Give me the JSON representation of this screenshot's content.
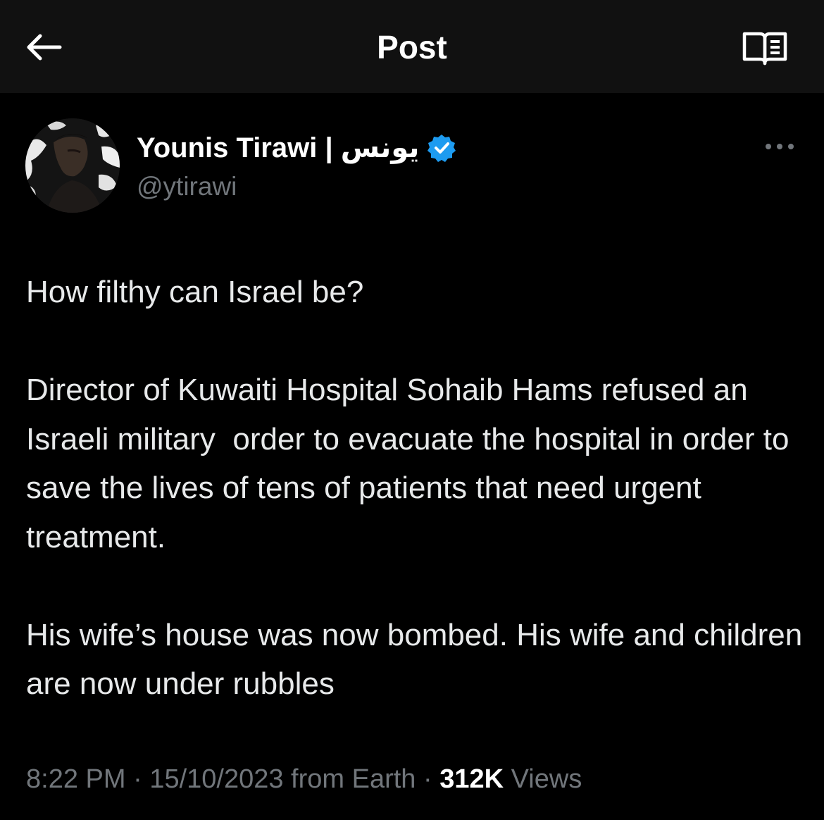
{
  "header": {
    "title": "Post",
    "back_icon": "arrow-left-icon",
    "reader_icon": "reader-mode-icon"
  },
  "author": {
    "name": "Younis Tirawi | يونس",
    "handle": "@ytirawi",
    "verified_color": "#1d9bf0"
  },
  "tweet": {
    "paragraphs": [
      "How filthy can Israel be?",
      "Director of Kuwaiti Hospital Sohaib Hams refused an Israeli military  order to evacuate the hospital in order to save the lives of tens of patients that need urgent treatment.",
      "His wife’s house was now bombed. His wife and children are now under rubbles"
    ]
  },
  "meta": {
    "time": "8:22 PM",
    "separator": " · ",
    "date": "15/10/2023",
    "source": " from Earth",
    "views_count": "312K",
    "views_label": " Views"
  },
  "colors": {
    "background": "#000000",
    "header_bg": "#111111",
    "text_primary": "#e7e9ea",
    "text_secondary": "#71767b",
    "accent": "#1d9bf0"
  }
}
